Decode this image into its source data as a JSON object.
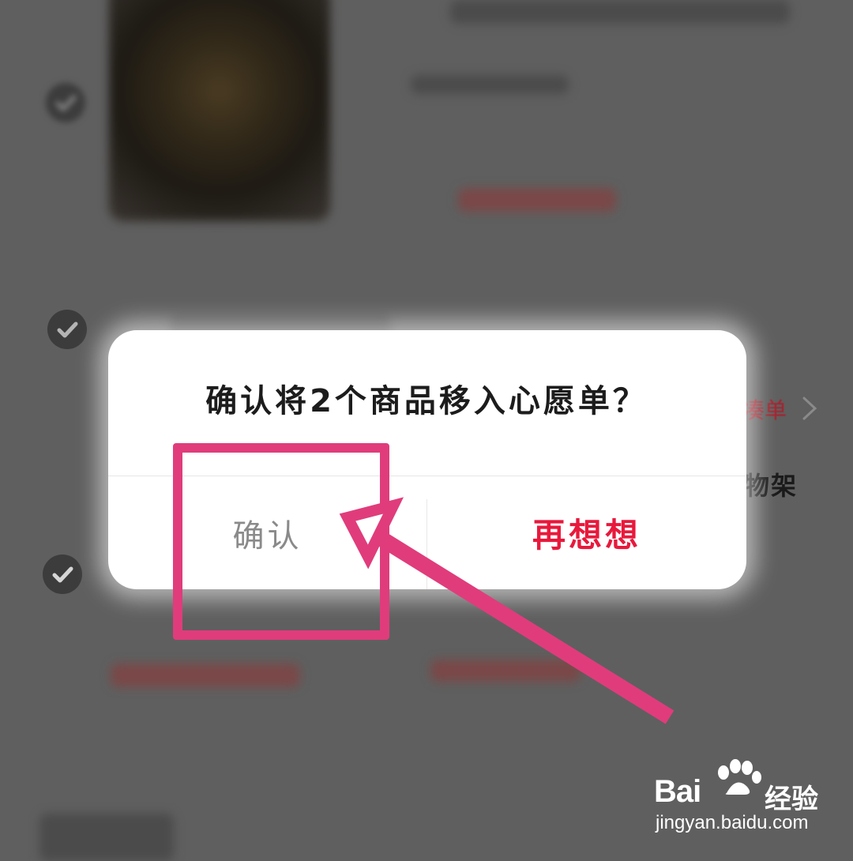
{
  "dialog": {
    "title": "确认将2个商品移入心愿单？",
    "confirm_label": "确认",
    "rethink_label": "再想想"
  },
  "background": {
    "side_tag": "凑单",
    "side_label": "物架"
  },
  "watermark": {
    "brand": "Bai",
    "brand_cn": "经验",
    "url": "jingyan.baidu.com"
  },
  "colors": {
    "accent_red": "#e8193c",
    "annotation_pink": "#e03c7c",
    "overlay": "#5f5f5f"
  },
  "icons": {
    "check": "check-circle-icon",
    "chevron": "chevron-right-icon",
    "arrow": "annotation-arrow",
    "paw": "baidu-paw-logo"
  }
}
